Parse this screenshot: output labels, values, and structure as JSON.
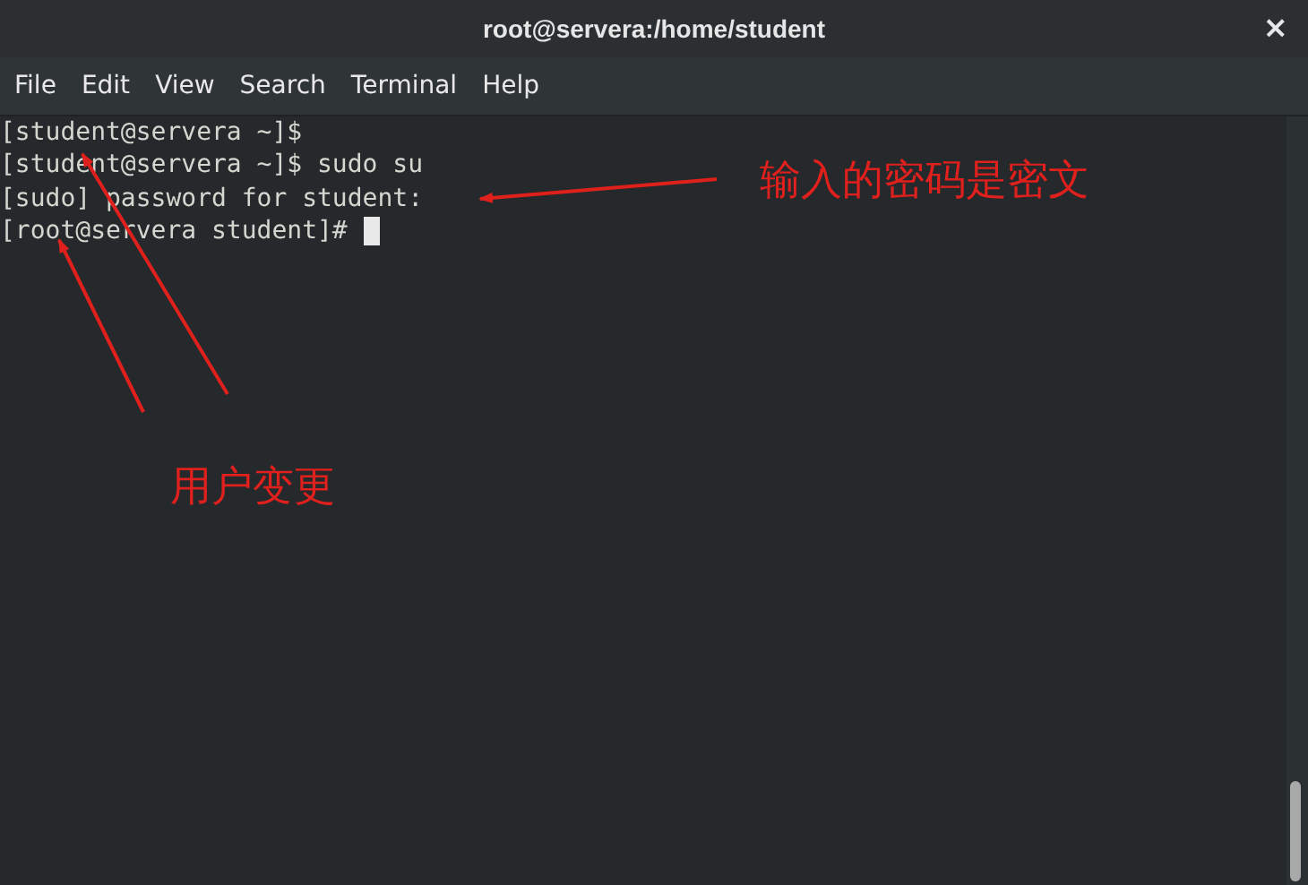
{
  "window": {
    "title": "root@servera:/home/student",
    "close": "×"
  },
  "menu": [
    "File",
    "Edit",
    "View",
    "Search",
    "Terminal",
    "Help"
  ],
  "terminal": {
    "lines": [
      "[student@servera ~]$",
      "[student@servera ~]$ sudo su",
      "[sudo] password for student:",
      "[root@servera student]# "
    ],
    "cursor": true
  },
  "annotations": [
    {
      "text": "输入的密码是密文"
    },
    {
      "text": "用户变更"
    }
  ]
}
